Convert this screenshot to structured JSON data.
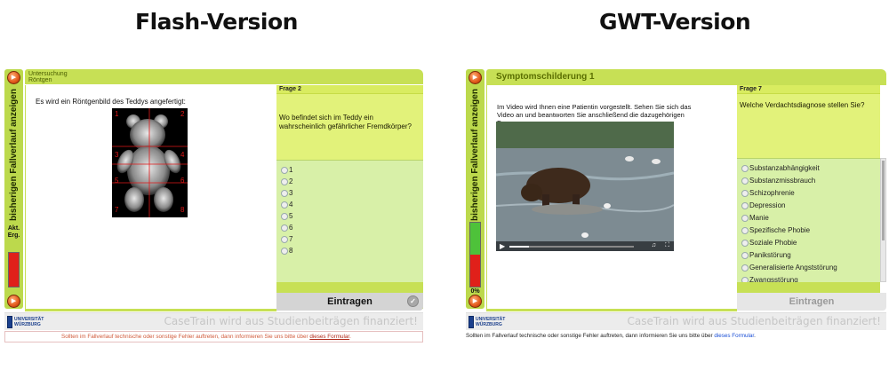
{
  "headings": {
    "left": "Flash-Version",
    "right": "GWT-Version"
  },
  "flash": {
    "sidebar_label": "bisherigen Fallverlauf anzeigen",
    "meter_label": "Akt. Erg.",
    "title_line1": "Untersuchung",
    "title_line2": "Röntgen",
    "content_text": "Es wird ein Röntgenbild des Teddys angefertigt:",
    "xray_numbers": [
      "1",
      "2",
      "3",
      "4",
      "5",
      "6",
      "7",
      "8"
    ],
    "question_header": "Frage 2",
    "question_text": "Wo befindet sich im Teddy ein wahrscheinlich gefährlicher Fremdkörper?",
    "answers": [
      "1",
      "2",
      "3",
      "4",
      "5",
      "6",
      "7",
      "8"
    ],
    "submit_label": "Eintragen",
    "funding_note": "CaseTrain wird aus Studienbeiträgen finanziert!",
    "logo_text": "UNIVERSITÄT WÜRZBURG",
    "bottom_note_pre": "Sollten im Fallverlauf technische oder sonstige Fehler auftreten, dann informieren Sie uns bitte über ",
    "bottom_note_link": "dieses Formular",
    "bottom_note_post": "."
  },
  "gwt": {
    "sidebar_label": "bisherigen Fallverlauf anzeigen",
    "meter_label": "0%",
    "title": "Symptomschilderung 1",
    "content_text": "Im Video wird Ihnen eine Patientin vorgestellt. Sehen Sie sich das Video an und beantworten Sie anschließend die dazugehörigen Fragen.",
    "question_header": "Frage 7",
    "question_text": "Welche Verdachtsdiagnose stellen Sie?",
    "answers": [
      "Substanzabhängigkeit",
      "Substanzmissbrauch",
      "Schizophrenie",
      "Depression",
      "Manie",
      "Spezifische Phobie",
      "Soziale Phobie",
      "Panikstörung",
      "Generalisierte Angststörung",
      "Zwangsstörung"
    ],
    "submit_label": "Eintragen",
    "funding_note": "CaseTrain wird aus Studienbeiträgen finanziert!",
    "logo_text": "UNIVERSITÄT WÜRZBURG",
    "bottom_note_pre": "Sollten im Fallverlauf technische oder sonstige Fehler auftreten, dann informieren Sie uns bitte über ",
    "bottom_note_link": "dieses Formular",
    "bottom_note_post": "."
  },
  "colors": {
    "accent_green": "#c7e055",
    "question_yellow": "#e2f27a",
    "answer_green": "#d8f0a8",
    "link_blue": "#1a4fd6",
    "meter_red": "#e0201a",
    "meter_green": "#4ec23a"
  },
  "icons": {
    "nav": "orange-circle-arrow-icon",
    "submit": "circle-check-icon",
    "video": "bear-video-frame"
  },
  "video_progress": 0.16
}
